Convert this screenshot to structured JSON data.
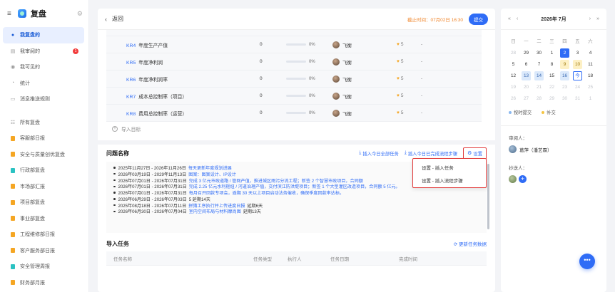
{
  "app": {
    "title": "复盘"
  },
  "sidebar": {
    "items": [
      {
        "label": "我复盘的",
        "active": true
      },
      {
        "label": "我审阅的",
        "badge": "1"
      },
      {
        "label": "我可见的"
      },
      {
        "label": "统计"
      },
      {
        "label": "消息推送规则"
      }
    ],
    "groups": [
      {
        "label": "所有复盘"
      },
      {
        "label": "客服部日报",
        "color": "#f5a623"
      },
      {
        "label": "安全与质量创优复盘",
        "color": "#f5a623"
      },
      {
        "label": "行政部复盘",
        "color": "#2ac2c2"
      },
      {
        "label": "市场部汇报",
        "color": "#f5a623"
      },
      {
        "label": "项目部复盘",
        "color": "#f5a623"
      },
      {
        "label": "事业部复盘",
        "color": "#f5a623"
      },
      {
        "label": "工程维修部日报",
        "color": "#f5a623"
      },
      {
        "label": "客户服务部日报",
        "color": "#f5a623"
      },
      {
        "label": "安全管理周报",
        "color": "#2ac2c2"
      },
      {
        "label": "财务部月报",
        "color": "#f5a623"
      }
    ]
  },
  "topbar": {
    "back": "返回",
    "deadline": "截止时间：07月02日 16:30",
    "submit": "提交"
  },
  "kr_rows": [
    {
      "code": "KR4",
      "name": "年度生产产值",
      "value": "0",
      "progress": 0,
      "progress_label": "0%",
      "owner": "飞衡",
      "heart": "5",
      "note": "-"
    },
    {
      "code": "KR5",
      "name": "年度净利润",
      "value": "0",
      "progress": 0,
      "progress_label": "0%",
      "owner": "飞衡",
      "heart": "5",
      "note": "-"
    },
    {
      "code": "KR6",
      "name": "年度净利润率",
      "value": "0",
      "progress": 0,
      "progress_label": "0%",
      "owner": "飞衡",
      "heart": "5",
      "note": "-"
    },
    {
      "code": "KR7",
      "name": "成本总控制率（项目）",
      "value": "0",
      "progress": 0,
      "progress_label": "0%",
      "owner": "飞衡",
      "heart": "5",
      "note": "-"
    },
    {
      "code": "KR8",
      "name": "费用总控制率（运营）",
      "value": "0",
      "progress": 0,
      "progress_label": "0%",
      "owner": "飞衡",
      "heart": "5",
      "note": "-"
    }
  ],
  "import_target": "导入目标",
  "issue": {
    "title": "问题名称",
    "action_all": "插入今日全部任务",
    "action_done": "插入今日已完成流程步骤",
    "settings": "设置",
    "items": [
      {
        "text": "2025年11月27日 - 2026年11月26日",
        "link": "每天更新年度规划进展",
        "ext": ""
      },
      {
        "text": "2026年03月19日 - 2029年11月13日",
        "link": "图案：图案设计、IP设计",
        "ext": ""
      },
      {
        "text": "2026年07月01日 - 2026年07月31日",
        "link": "完成 3 亿元市政道路 / 管网产值，推进城区雨污分流工程；新签 2 个智慧市政项目，合同额",
        "ext": ""
      },
      {
        "text": "2026年07月01日 - 2026年07月31日",
        "link": "完成 2.25 亿元水利枢纽 / 河道治理产值，交付滨江防洪堤项目；新签 1 个大型灌区改造项目，合同额 5 亿元。",
        "ext": ""
      },
      {
        "text": "2026年07月01日 - 2026年07月31日",
        "link": "每月召开回款专项会，逾期 30 天以上项目启动法务催收，确保季度回款率达标。",
        "ext": ""
      },
      {
        "text": "2026年06月29日 - 2026年07月03日",
        "link": "",
        "ext": "5 延期14天"
      },
      {
        "text": "2025年08月18日 - 2026年07月11日",
        "link": "拼猜工序执行并上传进度日报",
        "ext": "延期6天"
      },
      {
        "text": "2026年06月30日 - 2026年07月04日",
        "link": "室内空间布局与材料摩尚图",
        "ext": "延期13天"
      }
    ]
  },
  "dropdown": {
    "item1": "设置 - 插入任务",
    "item2": "设置 - 插入流程步骤"
  },
  "tasks": {
    "title": "导入任务",
    "refresh": "更新任务数据",
    "columns": [
      "任务名称",
      "任务类型",
      "执行人",
      "任务日期",
      "完成时间"
    ]
  },
  "calendar": {
    "month": "2026年 7月",
    "weekdays": [
      "日",
      "一",
      "二",
      "三",
      "四",
      "五",
      "六"
    ],
    "days": [
      {
        "d": "28",
        "s": "muted"
      },
      {
        "d": "29",
        "s": ""
      },
      {
        "d": "30",
        "s": ""
      },
      {
        "d": "1",
        "s": ""
      },
      {
        "d": "2",
        "s": "today"
      },
      {
        "d": "3",
        "s": ""
      },
      {
        "d": "4",
        "s": ""
      },
      {
        "d": "5",
        "s": ""
      },
      {
        "d": "6",
        "s": ""
      },
      {
        "d": "7",
        "s": ""
      },
      {
        "d": "8",
        "s": ""
      },
      {
        "d": "9",
        "s": "yellow"
      },
      {
        "d": "10",
        "s": "yellow"
      },
      {
        "d": "11",
        "s": ""
      },
      {
        "d": "12",
        "s": ""
      },
      {
        "d": "13",
        "s": "blue"
      },
      {
        "d": "14",
        "s": "blue"
      },
      {
        "d": "15",
        "s": ""
      },
      {
        "d": "16",
        "s": "blue"
      },
      {
        "d": "今",
        "s": "outline"
      },
      {
        "d": "18",
        "s": ""
      },
      {
        "d": "19",
        "s": "muted"
      },
      {
        "d": "20",
        "s": "muted"
      },
      {
        "d": "21",
        "s": "muted"
      },
      {
        "d": "22",
        "s": "muted"
      },
      {
        "d": "23",
        "s": "muted"
      },
      {
        "d": "24",
        "s": "muted"
      },
      {
        "d": "25",
        "s": "muted"
      },
      {
        "d": "26",
        "s": "muted"
      },
      {
        "d": "27",
        "s": "muted"
      },
      {
        "d": "28",
        "s": "muted"
      },
      {
        "d": "29",
        "s": "muted"
      },
      {
        "d": "30",
        "s": "muted"
      },
      {
        "d": "31",
        "s": "muted"
      },
      {
        "d": "1",
        "s": "muted"
      }
    ],
    "legend_ontime": "按时提交",
    "legend_late": "补交",
    "colors": {
      "ontime": "#8bb9f0",
      "late": "#f5c542"
    }
  },
  "reviewer": {
    "label": "审阅人：",
    "name": "葛萍（潘艺霖）"
  },
  "cc": {
    "label": "抄送人："
  }
}
